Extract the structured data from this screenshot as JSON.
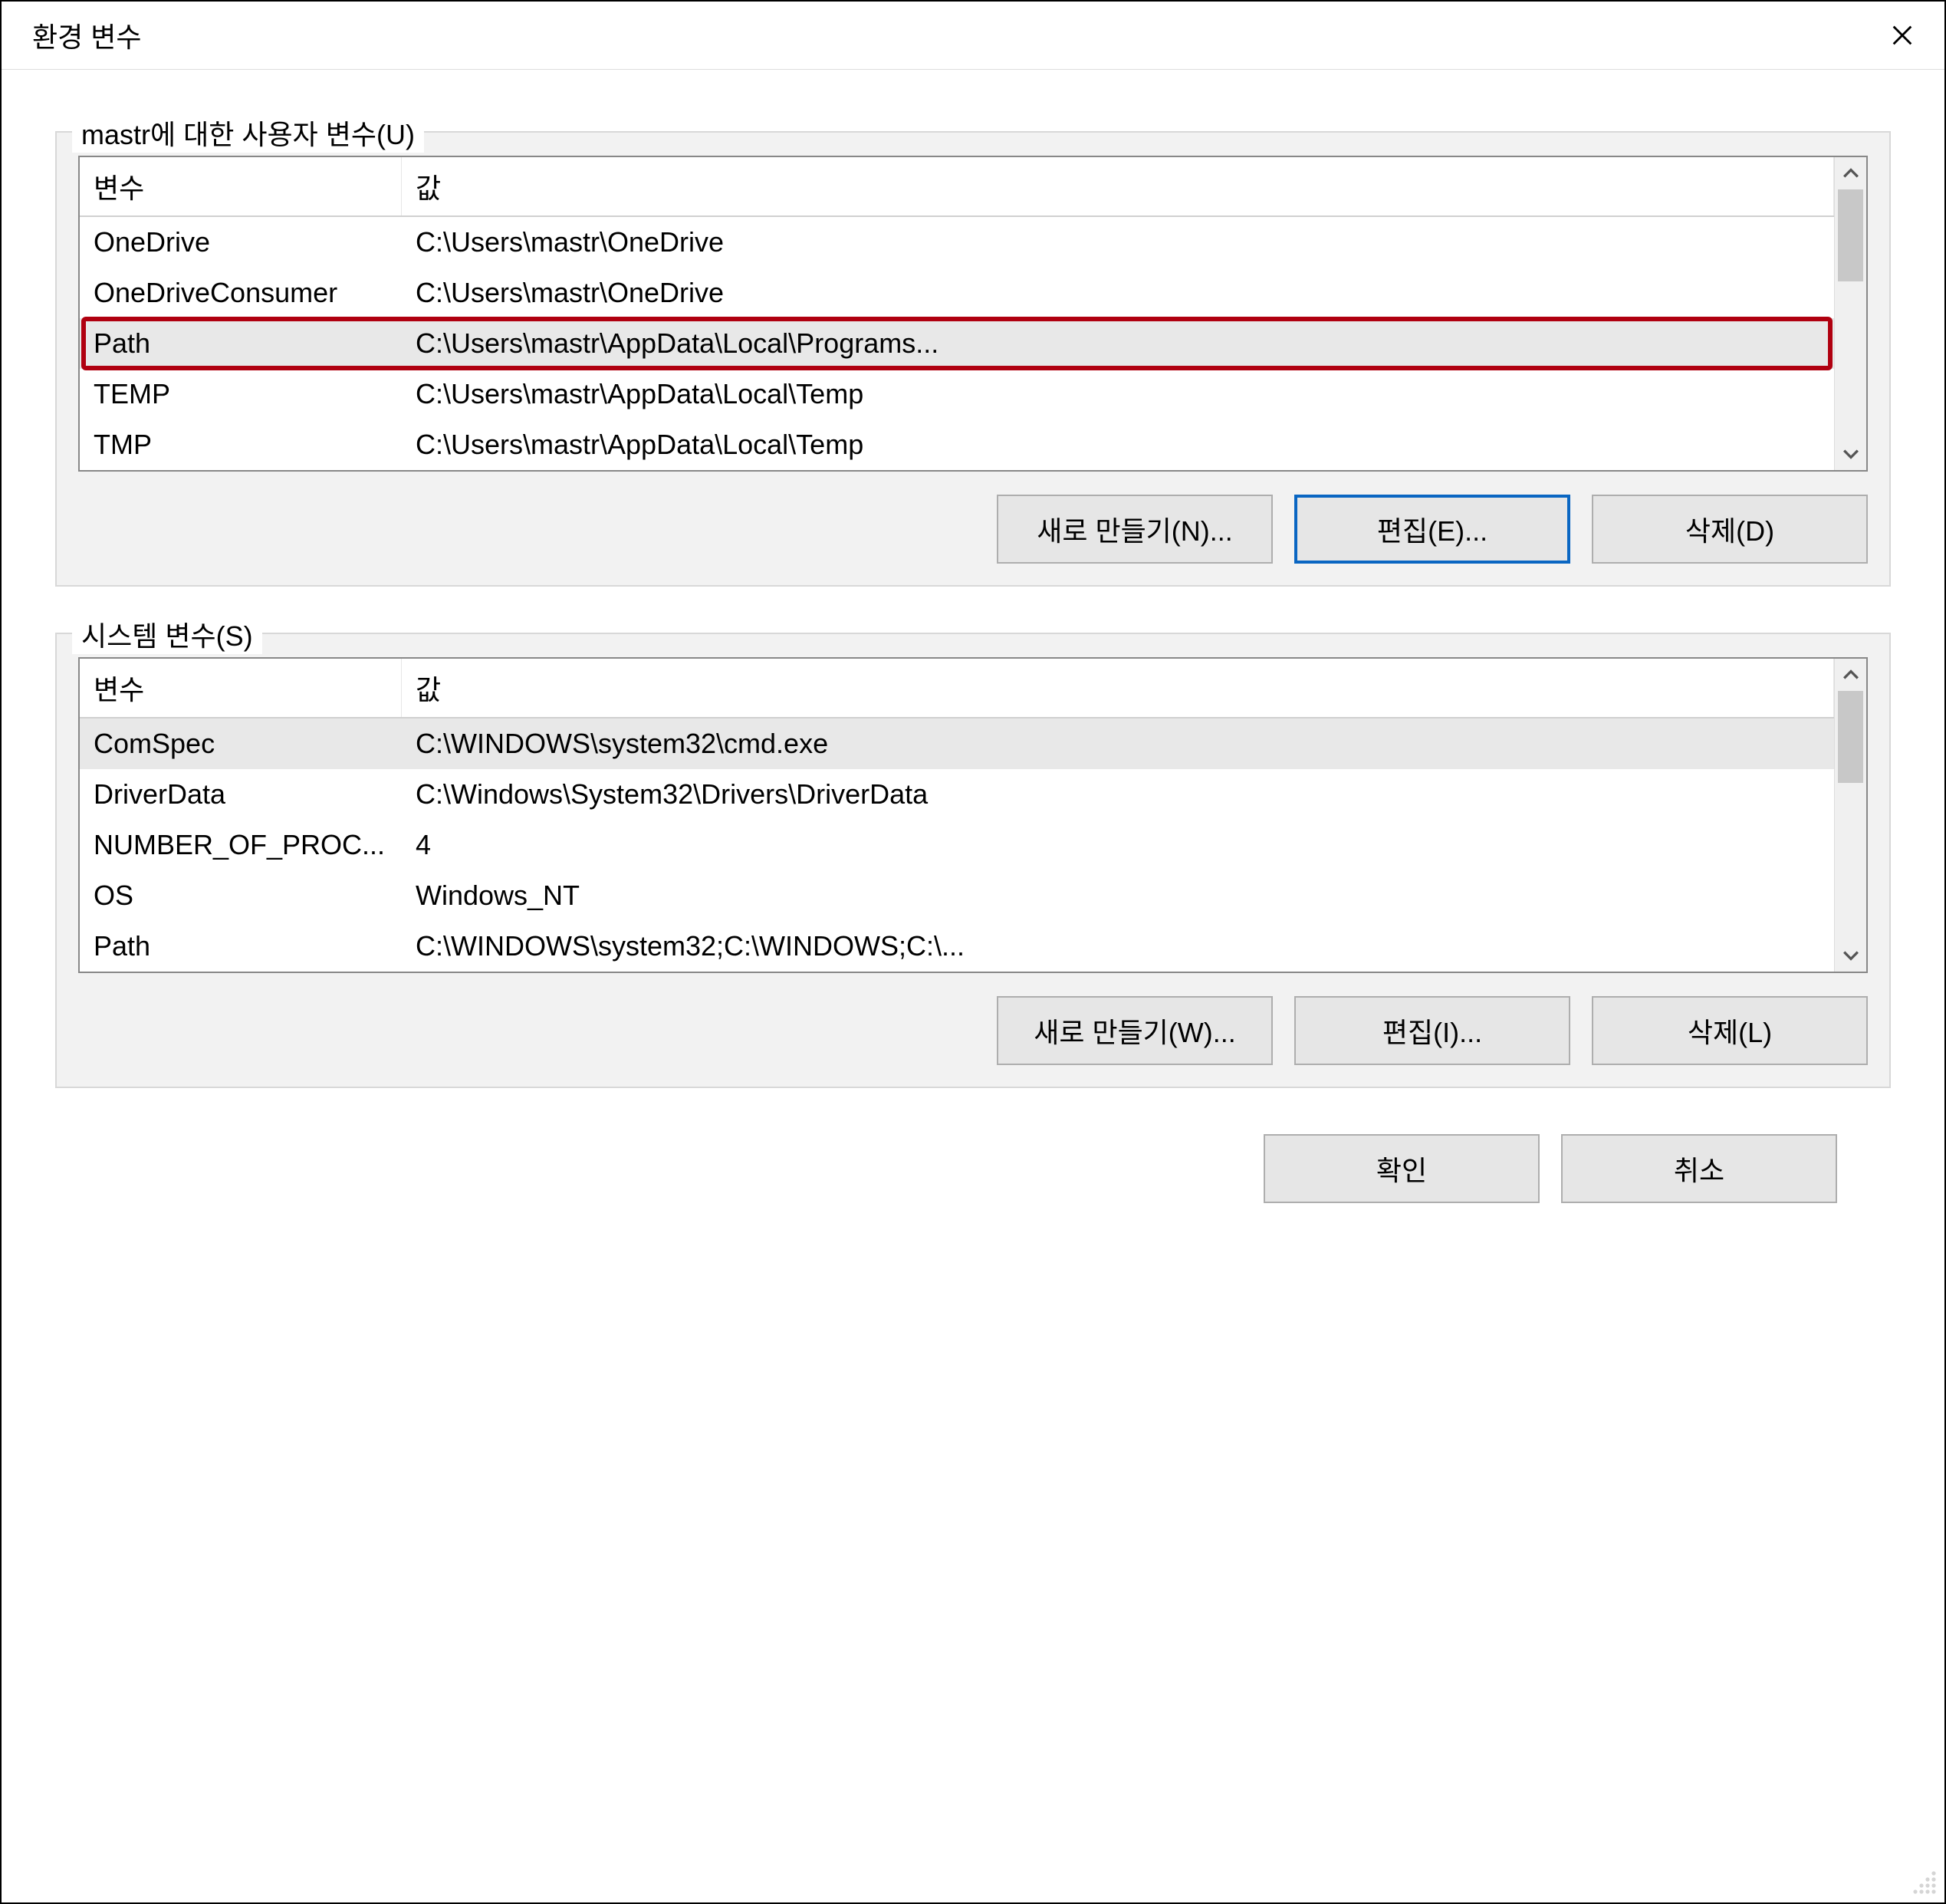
{
  "window": {
    "title": "환경 변수"
  },
  "user_vars": {
    "group_label": "mastr에 대한 사용자 변수(U)",
    "columns": {
      "name": "변수",
      "value": "값"
    },
    "rows": [
      {
        "name": "OneDrive",
        "value": "C:\\Users\\mastr\\OneDrive"
      },
      {
        "name": "OneDriveConsumer",
        "value": "C:\\Users\\mastr\\OneDrive"
      },
      {
        "name": "Path",
        "value": "C:\\Users\\mastr\\AppData\\Local\\Programs..."
      },
      {
        "name": "TEMP",
        "value": "C:\\Users\\mastr\\AppData\\Local\\Temp"
      },
      {
        "name": "TMP",
        "value": "C:\\Users\\mastr\\AppData\\Local\\Temp"
      }
    ],
    "highlighted_index": 2,
    "buttons": {
      "new": "새로 만들기(N)...",
      "edit": "편집(E)...",
      "delete": "삭제(D)"
    },
    "focused_button": "edit"
  },
  "system_vars": {
    "group_label": "시스템 변수(S)",
    "columns": {
      "name": "변수",
      "value": "값"
    },
    "rows": [
      {
        "name": "ComSpec",
        "value": "C:\\WINDOWS\\system32\\cmd.exe"
      },
      {
        "name": "DriverData",
        "value": "C:\\Windows\\System32\\Drivers\\DriverData"
      },
      {
        "name": "NUMBER_OF_PROC...",
        "value": "4"
      },
      {
        "name": "OS",
        "value": "Windows_NT"
      },
      {
        "name": "Path",
        "value": "C:\\WINDOWS\\system32;C:\\WINDOWS;C:\\..."
      }
    ],
    "selected_index": 0,
    "buttons": {
      "new": "새로 만들기(W)...",
      "edit": "편집(I)...",
      "delete": "삭제(L)"
    }
  },
  "dialog_buttons": {
    "ok": "확인",
    "cancel": "취소"
  }
}
